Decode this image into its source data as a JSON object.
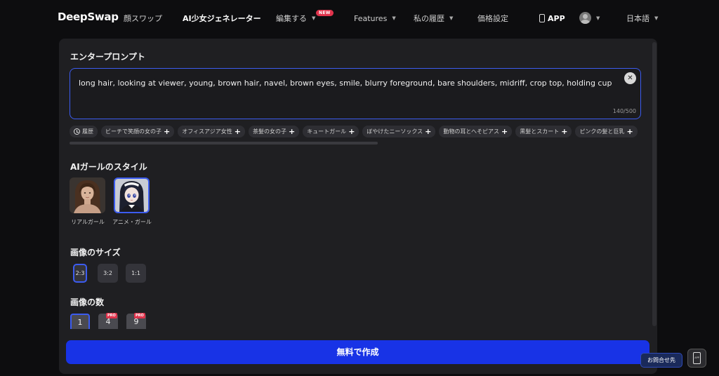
{
  "nav": {
    "logo": "DeepSwap",
    "face_swap": "顔スワップ",
    "ai_girl_generator": "AI少女ジェネレーター",
    "edit": "編集する",
    "new_badge": "NEW",
    "features": "Features",
    "history": "私の履歴",
    "pricing": "価格設定",
    "app": "APP",
    "language": "日本語"
  },
  "prompt": {
    "title": "エンタープロンプト",
    "value": "long hair, looking at viewer, young, brown hair, navel, brown eyes, smile, blurry foreground, bare shoulders, midriff, crop top, holding cup",
    "counter": "140/500",
    "history_chip": "履歴",
    "suggestions": [
      "ビーチで笑顔の女の子",
      "オフィスアジア女性",
      "茶髪の女の子",
      "キュートガール",
      "ぼやけたニーソックス",
      "動物の耳とへそピアス",
      "黒髪とスカート",
      "ピンクの髪と巨乳"
    ]
  },
  "style": {
    "title": "AIガールのスタイル",
    "options": [
      {
        "label": "リアルガール",
        "selected": false
      },
      {
        "label": "アニメ・ガール",
        "selected": true
      }
    ]
  },
  "size": {
    "title": "画像のサイズ",
    "options": [
      {
        "label": "2:3",
        "selected": true
      },
      {
        "label": "3:2",
        "selected": false
      },
      {
        "label": "1:1",
        "selected": false
      }
    ]
  },
  "count": {
    "title": "画像の数",
    "options": [
      {
        "label": "1",
        "selected": true,
        "pro": false
      },
      {
        "label": "4",
        "selected": false,
        "pro": true
      },
      {
        "label": "9",
        "selected": false,
        "pro": true
      }
    ],
    "pro_label": "PRO"
  },
  "actions": {
    "create": "無料で作成",
    "contact": "お問合せ先",
    "app_float": "APP"
  },
  "colors": {
    "accent": "#1833e6",
    "selected_border": "#3c5cf0",
    "badge": "#e0334c",
    "panel": "#1f1f22",
    "background": "#0d0d0f"
  }
}
